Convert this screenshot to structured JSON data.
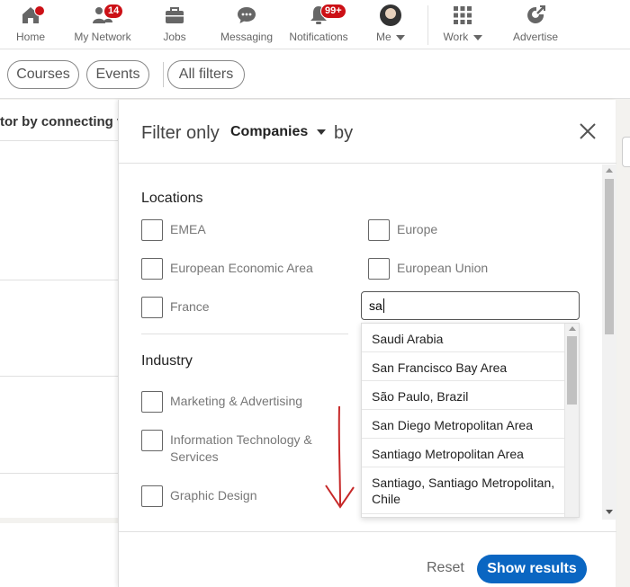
{
  "nav": {
    "items": [
      {
        "label": "Home",
        "icon": "home-icon",
        "badge": ""
      },
      {
        "label": "My Network",
        "icon": "network-icon",
        "badge": "14"
      },
      {
        "label": "Jobs",
        "icon": "briefcase-icon",
        "badge": ""
      },
      {
        "label": "Messaging",
        "icon": "messaging-icon",
        "badge": ""
      },
      {
        "label": "Notifications",
        "icon": "bell-icon",
        "badge": "99+"
      },
      {
        "label": "Me",
        "icon": "avatar",
        "badge": ""
      },
      {
        "label": "Work",
        "icon": "grid-icon",
        "badge": ""
      },
      {
        "label": "Advertise",
        "icon": "advertise-icon",
        "badge": ""
      }
    ]
  },
  "pills": [
    "Courses",
    "Events",
    "All filters"
  ],
  "background": {
    "text": "tor by connecting v"
  },
  "modal": {
    "filter_only": "Filter only",
    "entity": "Companies",
    "by": "by",
    "locations": {
      "title": "Locations",
      "options": [
        "EMEA",
        "Europe",
        "European Economic Area",
        "European Union",
        "France"
      ],
      "search_value": "sa",
      "suggestions": [
        "Saudi Arabia",
        "San Francisco Bay Area",
        "São Paulo, Brazil",
        "San Diego Metropolitan Area",
        "Santiago Metropolitan Area",
        "Santiago, Santiago Metropolitan, Chile"
      ]
    },
    "industry": {
      "title": "Industry",
      "options": [
        "Marketing & Advertising",
        "Information Technology & Services",
        "Graphic Design"
      ]
    },
    "reset": "Reset",
    "show_results": "Show results"
  },
  "colors": {
    "primary": "#0a66c2",
    "badge": "#cc1016",
    "annotation": "#c62828"
  }
}
